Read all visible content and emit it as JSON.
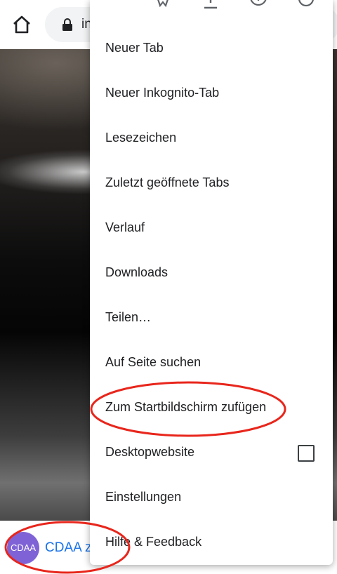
{
  "toolbar": {
    "url_text": "in"
  },
  "menu": {
    "items": [
      {
        "label": "Neuer Tab"
      },
      {
        "label": "Neuer Inkognito-Tab"
      },
      {
        "label": "Lesezeichen"
      },
      {
        "label": "Zuletzt geöffnete Tabs"
      },
      {
        "label": "Verlauf"
      },
      {
        "label": "Downloads"
      },
      {
        "label": "Teilen…"
      },
      {
        "label": "Auf Seite suchen"
      },
      {
        "label": "Zum Startbildschirm zufügen"
      },
      {
        "label": "Desktopwebsite",
        "checkbox_checked": false
      },
      {
        "label": "Einstellungen"
      },
      {
        "label": "Hilfe & Feedback"
      }
    ]
  },
  "banner": {
    "badge_text": "CDAA",
    "text": "CDAA zu"
  },
  "colors": {
    "annotation": "#e8261c",
    "badge": "#7f63d6",
    "link": "#1a73e8"
  }
}
